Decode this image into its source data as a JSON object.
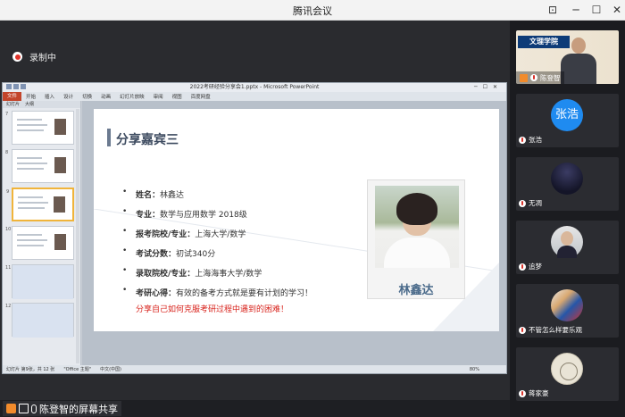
{
  "window": {
    "title": "腾讯会议"
  },
  "recording": {
    "label": "录制中"
  },
  "ppt": {
    "window_title": "2022考研经验分享会1.pptx - Microsoft PowerPoint",
    "ribbon_tabs": [
      "文件",
      "开始",
      "插入",
      "设计",
      "切换",
      "动画",
      "幻灯片放映",
      "审阅",
      "视图",
      "百度网盘"
    ],
    "panel_tabs": [
      "幻灯片",
      "大纲"
    ],
    "thumb_numbers": [
      "7",
      "8",
      "9",
      "10",
      "11",
      "12"
    ],
    "status": {
      "slide": "幻灯片 第9张，共 12 张",
      "theme": "\"Office 主题\"",
      "lang": "中文(中国)",
      "zoom": "80%"
    }
  },
  "slide": {
    "title": "分享嘉宾三",
    "items": [
      {
        "label": "姓名：",
        "value": "林鑫达"
      },
      {
        "label": "专业：",
        "value": "数学与应用数学 2018级"
      },
      {
        "label": "报考院校/专业：",
        "value": "上海大学/数学"
      },
      {
        "label": "考试分数：",
        "value": "初试340分"
      },
      {
        "label": "录取院校/专业：",
        "value": "上海海事大学/数学"
      },
      {
        "label": "考研心得：",
        "value": "有效的备考方式就是要有计划的学习！",
        "extra": "分享自己如何克服考研过程中遇到的困难！"
      }
    ],
    "photo_name": "林鑫达"
  },
  "share": {
    "label": "陈登智的屏幕共享"
  },
  "participants": [
    {
      "name": "陈登智",
      "banner": "文理学院"
    },
    {
      "name": "张浩",
      "avatar_text": "张浩"
    },
    {
      "name": "无凋"
    },
    {
      "name": "追梦"
    },
    {
      "name": "不管怎么样要乐观"
    },
    {
      "name": "蒋家豪"
    }
  ],
  "colors": {
    "accent": "#1f8bf0",
    "record": "#e0332a",
    "highlight": "#d8231c"
  }
}
